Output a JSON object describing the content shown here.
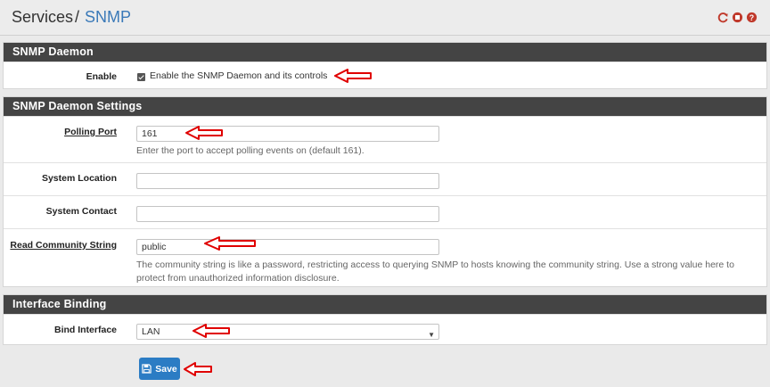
{
  "breadcrumb": {
    "parent": "Services",
    "separator": "/",
    "current": "SNMP"
  },
  "header_icons": [
    "reload-icon",
    "stop-icon",
    "help-icon"
  ],
  "sections": {
    "daemon": {
      "title": "SNMP Daemon",
      "enable_label": "Enable",
      "enable_checked": true,
      "enable_text": "Enable the SNMP Daemon and its controls"
    },
    "settings": {
      "title": "SNMP Daemon Settings",
      "polling_port": {
        "label": "Polling Port",
        "value": "161",
        "help": "Enter the port to accept polling events on (default 161)."
      },
      "system_location": {
        "label": "System Location",
        "value": ""
      },
      "system_contact": {
        "label": "System Contact",
        "value": ""
      },
      "read_community": {
        "label": "Read Community String",
        "value": "public",
        "help_line1": "The community string is like a password, restricting access to querying SNMP to hosts knowing the community string. Use a strong value here to",
        "help_line2": "protect from unauthorized information disclosure."
      }
    },
    "binding": {
      "title": "Interface Binding",
      "bind_interface": {
        "label": "Bind Interface",
        "value": "LAN"
      }
    }
  },
  "save_label": "Save",
  "colors": {
    "panel_header": "#444444",
    "accent": "#2b7cc4",
    "icon_red": "#c0392b",
    "annotation_arrow": "#e00000"
  }
}
